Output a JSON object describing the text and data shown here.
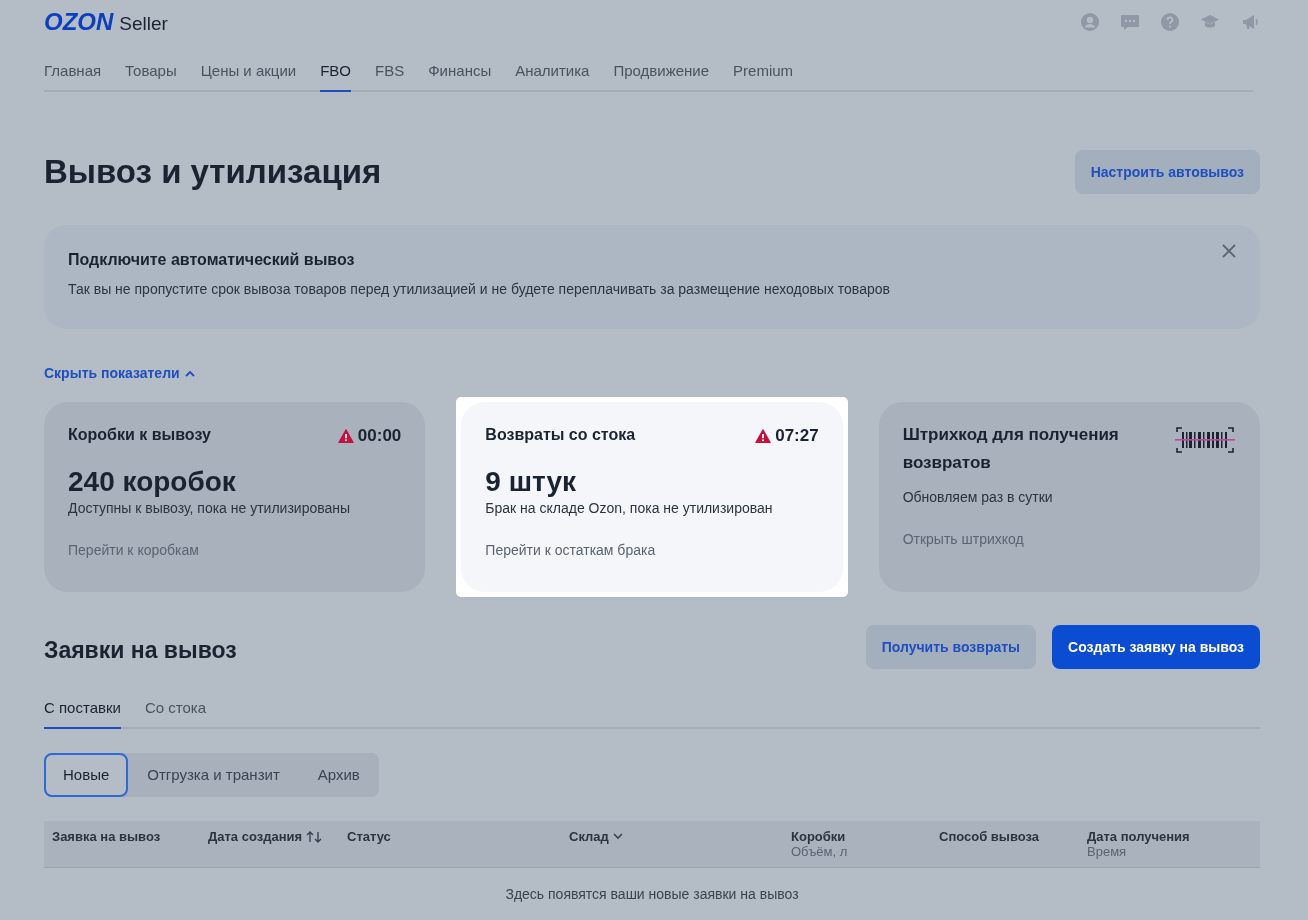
{
  "logo": {
    "brand": "OZON",
    "product": "Seller"
  },
  "nav": [
    {
      "label": "Главная",
      "selected": false
    },
    {
      "label": "Товары",
      "selected": false
    },
    {
      "label": "Цены и акции",
      "selected": false
    },
    {
      "label": "FBO",
      "selected": true
    },
    {
      "label": "FBS",
      "selected": false
    },
    {
      "label": "Финансы",
      "selected": false
    },
    {
      "label": "Аналитика",
      "selected": false
    },
    {
      "label": "Продвижение",
      "selected": false
    },
    {
      "label": "Premium",
      "selected": false
    }
  ],
  "page_title": "Вывоз и утилизация",
  "header_button": "Настроить автовывоз",
  "banner": {
    "title": "Подключите автоматический вывоз",
    "text": "Так вы не пропустите срок вывоза товаров перед утилизацией и не будете переплачивать за размещение неходовых товаров"
  },
  "metrics_toggle": {
    "label": "Скрыть показатели",
    "expanded": true
  },
  "cards": [
    {
      "kind": "metric",
      "highlighted": false,
      "title": "Коробки к вывозу",
      "timer": "00:00",
      "value": "240 коробок",
      "caption": "Доступны к вывозу, пока не утилизированы",
      "link": "Перейти к коробкам"
    },
    {
      "kind": "metric",
      "highlighted": true,
      "title": "Возвраты со стока",
      "timer": "07:27",
      "value": "9 штук",
      "caption": "Брак на складе Ozon, пока не утилизирован",
      "link": "Перейти к остаткам брака"
    },
    {
      "kind": "barcode",
      "highlighted": false,
      "title": "Штрихкод для получения возвратов",
      "caption": "Обновляем раз в сутки",
      "link": "Открыть штрихкод"
    }
  ],
  "section_title": "Заявки на вывоз",
  "section_buttons": [
    {
      "label": "Получить возвраты",
      "kind": "secondary"
    },
    {
      "label": "Создать заявку на вывоз",
      "kind": "primary"
    }
  ],
  "tabs": [
    {
      "label": "С поставки",
      "selected": true
    },
    {
      "label": "Со стока",
      "selected": false
    }
  ],
  "filters": [
    {
      "label": "Новые",
      "selected": true
    },
    {
      "label": "Отгрузка и транзит",
      "selected": false
    },
    {
      "label": "Архив",
      "selected": false
    }
  ],
  "table": {
    "columns": [
      {
        "label": "Заявка на вывоз"
      },
      {
        "label": "Дата создания",
        "sortable": true
      },
      {
        "label": "Статус"
      },
      {
        "label": "Склад",
        "filterable": true
      },
      {
        "label": "Коробки",
        "sub": "Объём, л"
      },
      {
        "label": "Способ вывоза"
      },
      {
        "label": "Дата получения",
        "sub": "Время"
      }
    ],
    "empty_message": "Здесь появятся ваши новые заявки на вывоз"
  }
}
